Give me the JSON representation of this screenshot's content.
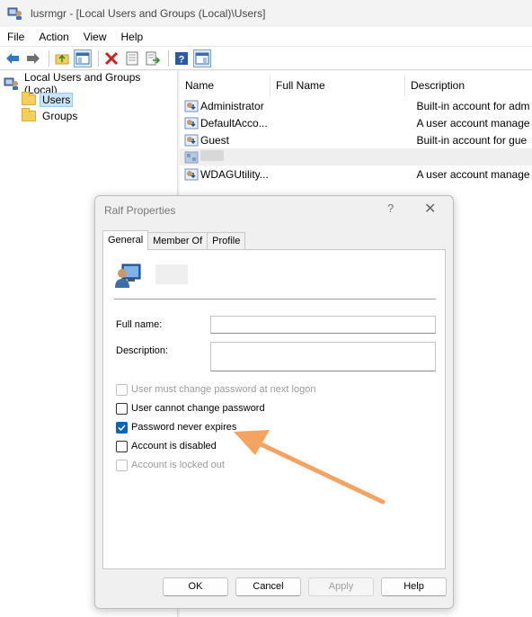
{
  "window": {
    "title": "lusrmgr - [Local Users and Groups (Local)\\Users]"
  },
  "menubar": [
    "File",
    "Action",
    "View",
    "Help"
  ],
  "toolbar": {
    "buttons": [
      "back-arrow-icon",
      "forward-arrow-icon",
      "up-folder-icon",
      "show-hide-tree-icon",
      "delete-icon",
      "properties-icon",
      "export-list-icon",
      "help-icon",
      "show-action-pane-icon"
    ]
  },
  "tree": {
    "root": "Local Users and Groups (Local)",
    "users": "Users",
    "groups": "Groups"
  },
  "list": {
    "columns": {
      "name": "Name",
      "full_name": "Full Name",
      "description": "Description"
    },
    "rows": [
      {
        "name": "Administrator",
        "full_name": "",
        "description": "Built-in account for adm"
      },
      {
        "name": "DefaultAcco...",
        "full_name": "",
        "description": "A user account manage"
      },
      {
        "name": "Guest",
        "full_name": "",
        "description": "Built-in account for gue"
      },
      {
        "name": "",
        "full_name": "",
        "description": ""
      },
      {
        "name": "WDAGUtility...",
        "full_name": "",
        "description": "A user account manage"
      }
    ]
  },
  "dialog": {
    "title": "Ralf Properties",
    "help_glyph": "?",
    "close_glyph": "✕",
    "tabs": [
      "General",
      "Member Of",
      "Profile"
    ],
    "active_tab": "General",
    "full_name_label": "Full name:",
    "full_name_value": "",
    "description_label": "Description:",
    "description_value": "",
    "checkboxes": [
      {
        "label": "User must change password at next logon",
        "checked": false,
        "enabled": false
      },
      {
        "label": "User cannot change password",
        "checked": false,
        "enabled": true
      },
      {
        "label": "Password never expires",
        "checked": true,
        "enabled": true
      },
      {
        "label": "Account is disabled",
        "checked": false,
        "enabled": true
      },
      {
        "label": "Account is locked out",
        "checked": false,
        "enabled": false
      }
    ],
    "buttons": {
      "ok": "OK",
      "cancel": "Cancel",
      "apply": "Apply",
      "help": "Help"
    }
  },
  "annotation": {
    "arrow_color": "#f4a460"
  }
}
